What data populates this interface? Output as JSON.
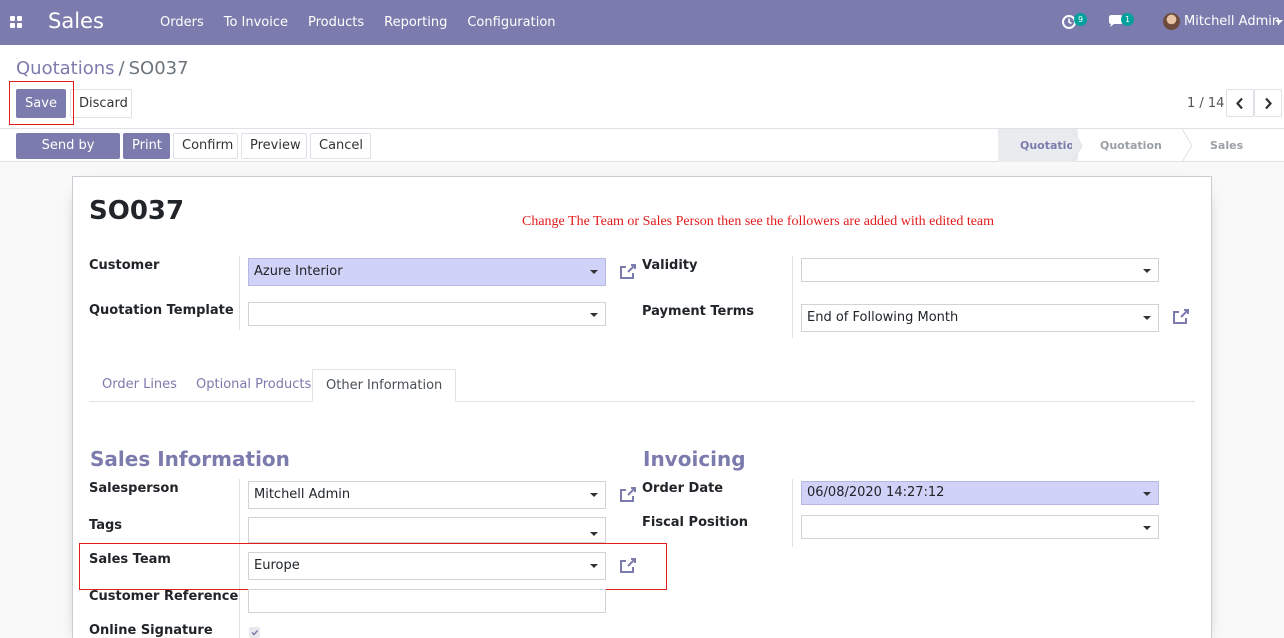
{
  "navbar": {
    "app_title": "Sales",
    "menu": [
      "Orders",
      "To Invoice",
      "Products",
      "Reporting",
      "Configuration"
    ],
    "activity_count": "9",
    "messages_count": "1",
    "user_name": "Mitchell Admin"
  },
  "breadcrumb": {
    "parent": "Quotations",
    "separator": "/",
    "current": "SO037"
  },
  "control_panel": {
    "save_label": "Save",
    "discard_label": "Discard",
    "pager_value": "1 / 14"
  },
  "header_buttons": {
    "send_email": "Send by Email",
    "print": "Print",
    "confirm": "Confirm",
    "preview": "Preview",
    "cancel": "Cancel"
  },
  "status_steps": [
    "Quotation",
    "Quotation Sent",
    "Sales Order"
  ],
  "status_active_index": 0,
  "form": {
    "record_name": "SO037",
    "annotation": "Change The Team or Sales Person then see the followers are added with edited team",
    "customer_label": "Customer",
    "customer_value": "Azure Interior",
    "template_label": "Quotation Template",
    "template_value": "",
    "validity_label": "Validity",
    "validity_value": "",
    "payment_terms_label": "Payment Terms",
    "payment_terms_value": "End of Following Month"
  },
  "tabs": [
    "Order Lines",
    "Optional Products",
    "Other Information"
  ],
  "active_tab_index": 2,
  "sales_info": {
    "title": "Sales Information",
    "salesperson_label": "Salesperson",
    "salesperson_value": "Mitchell Admin",
    "tags_label": "Tags",
    "tags_value": "",
    "sales_team_label": "Sales Team",
    "sales_team_value": "Europe",
    "customer_ref_label": "Customer Reference",
    "customer_ref_value": "",
    "online_signature_label": "Online Signature",
    "online_signature_checked": true
  },
  "invoicing": {
    "title": "Invoicing",
    "order_date_label": "Order Date",
    "order_date_value": "06/08/2020 14:27:12",
    "fiscal_position_label": "Fiscal Position",
    "fiscal_position_value": ""
  },
  "colors": {
    "brand": "#7c7bad",
    "highlight_field": "#d1d2f7",
    "annotation_red": "#e21b1b",
    "badge_teal": "#00a09d"
  }
}
